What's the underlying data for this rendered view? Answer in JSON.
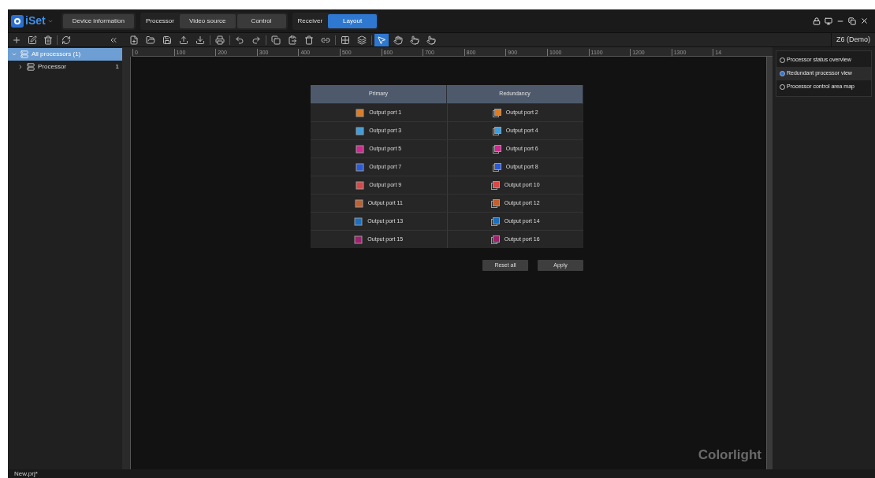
{
  "app": {
    "name": "iSet"
  },
  "tabs": [
    {
      "kind": "tab",
      "label": "Device information",
      "selected": false
    },
    {
      "kind": "group",
      "label": "Processor"
    },
    {
      "kind": "tab",
      "label": "Video source",
      "selected": false
    },
    {
      "kind": "tab",
      "label": "Control",
      "selected": false
    },
    {
      "kind": "group",
      "label": "Receiver"
    },
    {
      "kind": "tab",
      "label": "Layout",
      "selected": true
    }
  ],
  "device": "Z6 (Demo)",
  "tree": [
    {
      "label": "All processors (1)",
      "expanded": true,
      "selected": true,
      "children": [
        {
          "label": "Processor",
          "count": "1",
          "expanded": false,
          "selected": false
        }
      ]
    }
  ],
  "ruler": [
    "0",
    "100",
    "200",
    "300",
    "400",
    "500",
    "600",
    "700",
    "800",
    "900",
    "1000",
    "1100",
    "1200",
    "1300",
    "14"
  ],
  "table": {
    "columns": [
      "Primary",
      "Redundancy"
    ],
    "rows": [
      {
        "primary": "Output port 1",
        "redundancy": "Output port 2",
        "color": "#e07b20"
      },
      {
        "primary": "Output port 3",
        "redundancy": "Output port 4",
        "color": "#3a9ee0"
      },
      {
        "primary": "Output port 5",
        "redundancy": "Output port 6",
        "color": "#d02890"
      },
      {
        "primary": "Output port 7",
        "redundancy": "Output port 8",
        "color": "#2a5ad8"
      },
      {
        "primary": "Output port 9",
        "redundancy": "Output port 10",
        "color": "#d84848"
      },
      {
        "primary": "Output port 11",
        "redundancy": "Output port 12",
        "color": "#c06030"
      },
      {
        "primary": "Output port 13",
        "redundancy": "Output port 14",
        "color": "#1a70c0"
      },
      {
        "primary": "Output port 15",
        "redundancy": "Output port 16",
        "color": "#a02070"
      }
    ]
  },
  "buttons": [
    "Reset all",
    "Apply"
  ],
  "watermark_logo": "Colorlight",
  "views": [
    {
      "label": "Processor status overview",
      "selected": false
    },
    {
      "label": "Redundant processor view",
      "selected": true
    },
    {
      "label": "Processor control area map",
      "selected": false
    }
  ],
  "status_bar": "New.prj*"
}
